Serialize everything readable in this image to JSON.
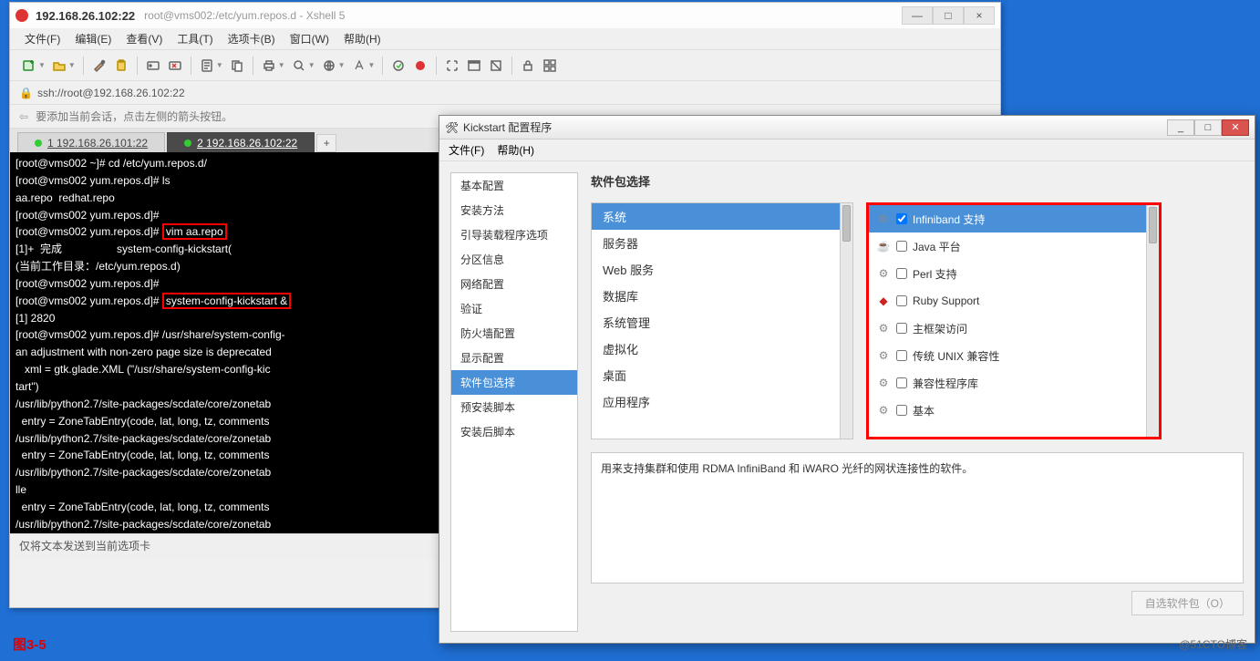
{
  "xshell": {
    "title_main": "192.168.26.102:22",
    "title_sub": "root@vms002:/etc/yum.repos.d - Xshell 5",
    "menu": [
      "文件(F)",
      "编辑(E)",
      "查看(V)",
      "工具(T)",
      "选项卡(B)",
      "窗口(W)",
      "帮助(H)"
    ],
    "address": "ssh://root@192.168.26.102:22",
    "arrow_tip": "要添加当前会话，点击左侧的箭头按钮。",
    "tabs": [
      {
        "label": "1 192.168.26.101:22",
        "active": false
      },
      {
        "label": "2 192.168.26.102:22",
        "active": true
      }
    ],
    "status": "仅将文本发送到当前选项卡",
    "toolbar_icons": [
      "new-session-icon",
      "open-icon",
      "color-scheme-icon",
      "paste-icon",
      "reconnect-icon",
      "disconnect-icon",
      "properties-icon",
      "copy-icon",
      "print-icon",
      "find-icon",
      "encoding-icon",
      "font-icon",
      "zoom-icon",
      "highlight-icon",
      "start-log-icon",
      "stop-log-icon",
      "fullscreen-icon",
      "transparency-icon",
      "lock-icon",
      "help-icon",
      "tile-icon"
    ],
    "terminal": {
      "lines_before": "[root@vms002 ~]# cd /etc/yum.repos.d/\n[root@vms002 yum.repos.d]# ls\naa.repo  redhat.repo\n[root@vms002 yum.repos.d]#\n[root@vms002 yum.repos.d]# ",
      "cmd1": "vim aa.repo",
      "lines_mid": "\n[1]+  完成                  system-config-kickstart(\n(当前工作目录：/etc/yum.repos.d)\n[root@vms002 yum.repos.d]#\n[root@vms002 yum.repos.d]# ",
      "cmd2": "system-config-kickstart &",
      "lines_after": "\n[1] 2820\n[root@vms002 yum.repos.d]# /usr/share/system-config-\nan adjustment with non-zero page size is deprecated\n   xml = gtk.glade.XML (\"/usr/share/system-config-kic\ntart\")\n/usr/lib/python2.7/site-packages/scdate/core/zonetab\n  entry = ZoneTabEntry(code, lat, long, tz, comments\n/usr/lib/python2.7/site-packages/scdate/core/zonetab\n  entry = ZoneTabEntry(code, lat, long, tz, comments\n/usr/lib/python2.7/site-packages/scdate/core/zonetab\nlle\n  entry = ZoneTabEntry(code, lat, long, tz, comments\n/usr/lib/python2.7/site-packages/scdate/core/zonetab"
    }
  },
  "kickstart": {
    "title": "Kickstart 配置程序",
    "menu": [
      "文件(F)",
      "帮助(H)"
    ],
    "sidebar": [
      "基本配置",
      "安装方法",
      "引导装载程序选项",
      "分区信息",
      "网络配置",
      "验证",
      "防火墙配置",
      "显示配置",
      "软件包选择",
      "预安装脚本",
      "安装后脚本"
    ],
    "sidebar_selected_index": 8,
    "heading": "软件包选择",
    "left_list": [
      "系统",
      "服务器",
      "Web 服务",
      "数据库",
      "系统管理",
      "虚拟化",
      "桌面",
      "应用程序"
    ],
    "left_selected_index": 0,
    "right_list": [
      {
        "label": "Infiniband 支持",
        "checked": true,
        "icon": "gear"
      },
      {
        "label": "Java 平台",
        "checked": false,
        "icon": "java"
      },
      {
        "label": "Perl 支持",
        "checked": false,
        "icon": "gear"
      },
      {
        "label": "Ruby Support",
        "checked": false,
        "icon": "ruby"
      },
      {
        "label": "主框架访问",
        "checked": false,
        "icon": "gear"
      },
      {
        "label": "传统 UNIX 兼容性",
        "checked": false,
        "icon": "gear"
      },
      {
        "label": "兼容性程序库",
        "checked": false,
        "icon": "gear"
      },
      {
        "label": "基本",
        "checked": false,
        "icon": "gear"
      }
    ],
    "right_selected_index": 0,
    "description": "用来支持集群和使用 RDMA InfiniBand 和 iWARO 光纤的网状连接性的软件。",
    "custom_button": "自选软件包（O）"
  },
  "figure_label": "图3-5",
  "watermark": "@51CTO博客"
}
